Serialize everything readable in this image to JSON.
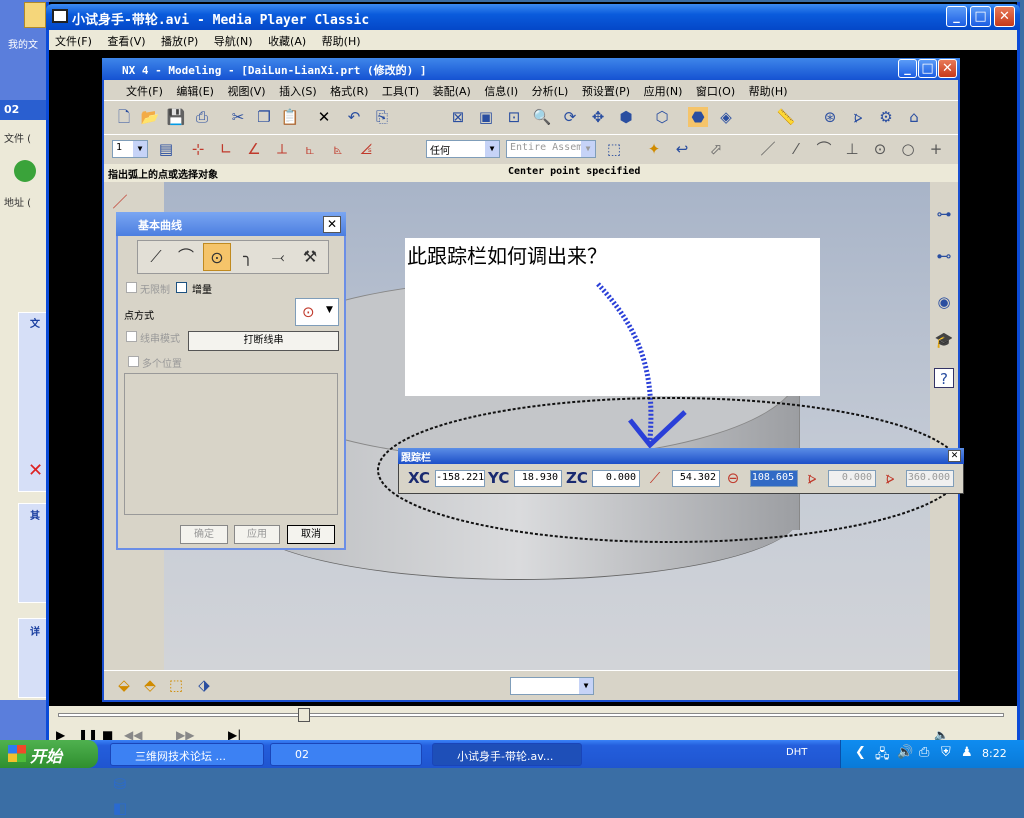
{
  "desktop": {
    "icon_label": "我的文"
  },
  "bg_window": {
    "title": "02",
    "menu": "文件 (",
    "address": "地址 (",
    "sections": [
      "文",
      "其",
      "详"
    ]
  },
  "mpc": {
    "title": "小试身手-带轮.avi - Media Player Classic",
    "menu": [
      "文件(F)",
      "查看(V)",
      "播放(P)",
      "导航(N)",
      "收藏(A)",
      "帮助(H)"
    ]
  },
  "nx": {
    "title": "NX 4 - Modeling - [DaiLun-LianXi.prt  (修改的) ]",
    "menu": [
      "文件(F)",
      "编辑(E)",
      "视图(V)",
      "插入(S)",
      "格式(R)",
      "工具(T)",
      "装配(A)",
      "信息(I)",
      "分析(L)",
      "预设置(P)",
      "应用(N)",
      "窗口(O)",
      "帮助(H)"
    ],
    "layer_combo": "1",
    "filter_combo": "任何",
    "assembly_combo": "Entire Assemb",
    "status_left": "指出弧上的点或选择对象",
    "status_right": "Center point specified"
  },
  "annotation": {
    "text": "此跟踪栏如何调出来？"
  },
  "basic_curves": {
    "title": "基本曲线",
    "unlimited": "无限制",
    "increment": "增量",
    "point_method": "点方式",
    "string_mode": "线串模式",
    "break_string": "打断线串",
    "multi_position": "多个位置",
    "ok": "确定",
    "apply": "应用",
    "cancel": "取消"
  },
  "tracking_bar": {
    "title": "跟踪栏",
    "xc_label": "XC",
    "xc": "-158.221",
    "yc_label": "YC",
    "yc": "18.930",
    "zc_label": "ZC",
    "zc": "0.000",
    "radius": "54.302",
    "diameter": "108.605",
    "start_angle": "0.000",
    "end_angle": "360.000"
  },
  "taskbar": {
    "start": "开始",
    "tasks": [
      "三维网技术论坛 ...",
      "02",
      "小试身手-带轮.av..."
    ],
    "ime": "DHT",
    "clock": "8:22"
  }
}
